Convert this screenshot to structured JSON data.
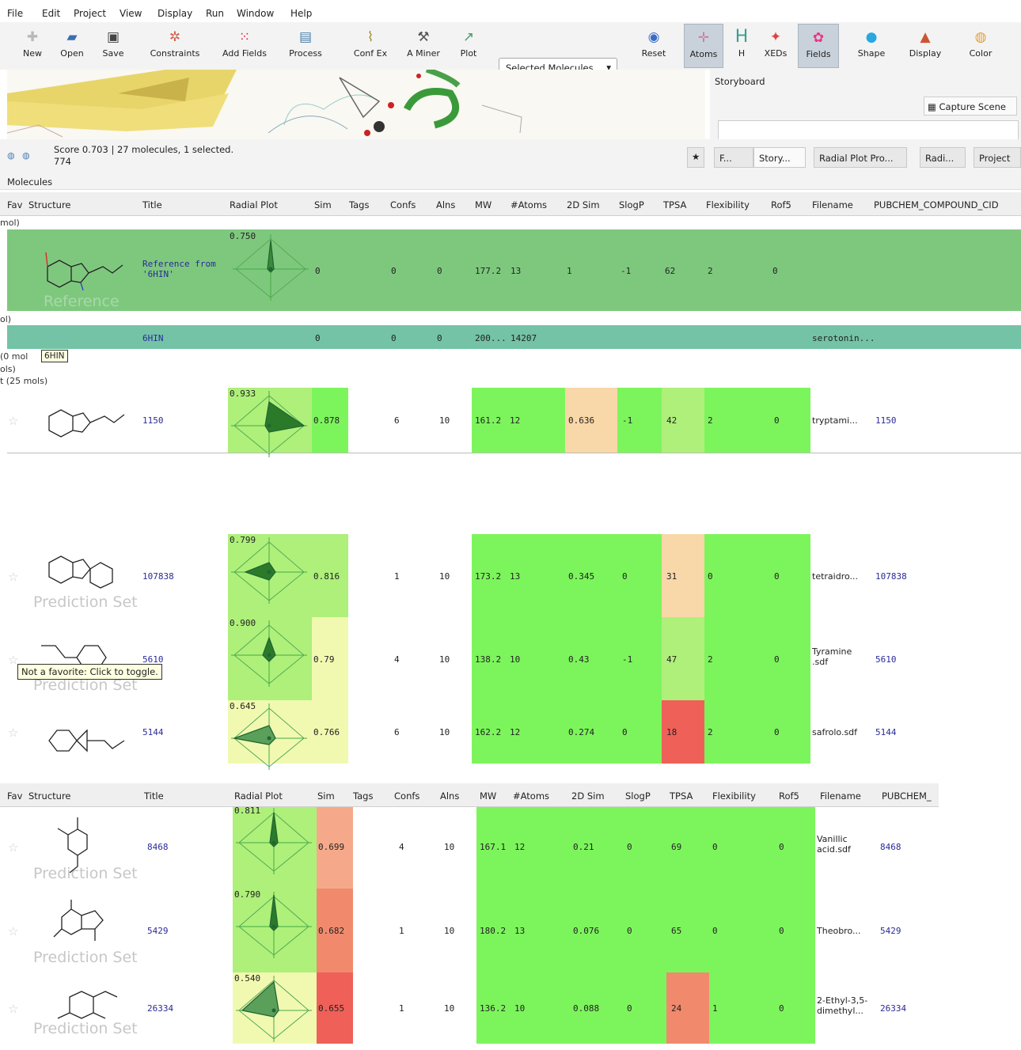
{
  "menu": [
    "File",
    "Edit",
    "Project",
    "View",
    "Display",
    "Run",
    "Window",
    "Help"
  ],
  "toolbar": {
    "new": "New",
    "open": "Open",
    "save": "Save",
    "constraints": "Constraints",
    "add_fields": "Add Fields",
    "process": "Process",
    "conf_ex": "Conf Ex",
    "a_miner": "A Miner",
    "plot": "Plot",
    "selected": "Selected Molecules",
    "reset": "Reset",
    "atoms": "Atoms",
    "h": "H",
    "xeds": "XEDs",
    "fields": "Fields",
    "shape": "Shape",
    "display": "Display",
    "color": "Color"
  },
  "storyboard": {
    "title": "Storyboard",
    "capture": "Capture Scene"
  },
  "status": {
    "line1": "Score 0.703 | 27 molecules, 1 selected.",
    "line2": "774"
  },
  "tabs": [
    "F...",
    "Story...",
    "Radial Plot Pro...",
    "Radi...",
    "Project"
  ],
  "molecules_title": "Molecules",
  "columns": [
    "Fav",
    "Structure",
    "Title",
    "Radial Plot",
    "Sim",
    "Tags",
    "Confs",
    "Alns",
    "MW",
    "#Atoms",
    "2D Sim",
    "SlogP",
    "TPSA",
    "Flexibility",
    "Rof5",
    "Filename",
    "PUBCHEM_COMPOUND_CID"
  ],
  "columns_short_last": "PUBCHEM_",
  "groups": {
    "g1": "mol)",
    "g2": "ol)",
    "g3": "(0 mol",
    "g4": "ols)",
    "g5": "t (25 mols)"
  },
  "reference": {
    "title": "Reference from '6HIN'",
    "radial": "0.750",
    "sim": "0",
    "confs": "0",
    "alns": "0",
    "mw": "177.2",
    "atoms": "13",
    "sim2d": "1",
    "slogp": "-1",
    "tpsa": "62",
    "flex": "2",
    "rof5": "0",
    "watermark": "Reference"
  },
  "protein": {
    "title": "6HIN",
    "sim": "0",
    "confs": "0",
    "alns": "0",
    "mw": "200...",
    "atoms": "14207",
    "filename": "serotonin...",
    "tooltip": "6HIN"
  },
  "rows": [
    {
      "title": "1150",
      "radial": "0.933",
      "sim": "0.878",
      "confs": "6",
      "alns": "10",
      "mw": "161.2",
      "atoms": "12",
      "sim2d": "0.636",
      "slogp": "-1",
      "tpsa": "42",
      "flex": "2",
      "rof5": "0",
      "filename": "tryptami...",
      "cid": "1150",
      "watermark": ""
    },
    {
      "title": "107838",
      "radial": "0.799",
      "sim": "0.816",
      "confs": "1",
      "alns": "10",
      "mw": "173.2",
      "atoms": "13",
      "sim2d": "0.345",
      "slogp": "0",
      "tpsa": "31",
      "flex": "0",
      "rof5": "0",
      "filename": "tetraidro...",
      "cid": "107838",
      "watermark": "Prediction Set"
    },
    {
      "title": "5610",
      "radial": "0.900",
      "sim": "0.79",
      "confs": "4",
      "alns": "10",
      "mw": "138.2",
      "atoms": "10",
      "sim2d": "0.43",
      "slogp": "-1",
      "tpsa": "47",
      "flex": "2",
      "rof5": "0",
      "filename": "Tyramine .sdf",
      "cid": "5610",
      "watermark": "Prediction Set"
    },
    {
      "title": "5144",
      "radial": "0.645",
      "sim": "0.766",
      "confs": "6",
      "alns": "10",
      "mw": "162.2",
      "atoms": "12",
      "sim2d": "0.274",
      "slogp": "0",
      "tpsa": "18",
      "flex": "2",
      "rof5": "0",
      "filename": "safrolo.sdf",
      "cid": "5144",
      "watermark": ""
    },
    {
      "title": "8468",
      "radial": "0.811",
      "sim": "0.699",
      "confs": "4",
      "alns": "10",
      "mw": "167.1",
      "atoms": "12",
      "sim2d": "0.21",
      "slogp": "0",
      "tpsa": "69",
      "flex": "0",
      "rof5": "0",
      "filename": "Vanillic acid.sdf",
      "cid": "8468",
      "watermark": "Prediction Set"
    },
    {
      "title": "5429",
      "radial": "0.790",
      "sim": "0.682",
      "confs": "1",
      "alns": "10",
      "mw": "180.2",
      "atoms": "13",
      "sim2d": "0.076",
      "slogp": "0",
      "tpsa": "65",
      "flex": "0",
      "rof5": "0",
      "filename": "Theobro...",
      "cid": "5429",
      "watermark": "Prediction Set"
    },
    {
      "title": "26334",
      "radial": "0.540",
      "sim": "0.655",
      "confs": "1",
      "alns": "10",
      "mw": "136.2",
      "atoms": "10",
      "sim2d": "0.088",
      "slogp": "0",
      "tpsa": "24",
      "flex": "1",
      "rof5": "0",
      "filename": "2-Ethyl-3,5-dimethyl...",
      "cid": "26334",
      "watermark": "Prediction Set"
    }
  ],
  "tooltip_fav": "Not a favorite: Click to toggle.",
  "colors": {
    "ref_green": "#7ec87e",
    "prot_teal": "#74c3a6",
    "bright_green": "#7cf55c",
    "light_green": "#aef07a",
    "pale_yellow": "#f1f9b0",
    "peach": "#f8d7a8",
    "salmon": "#f6a98a",
    "red": "#ef6058",
    "orange_red": "#f18a6d"
  }
}
